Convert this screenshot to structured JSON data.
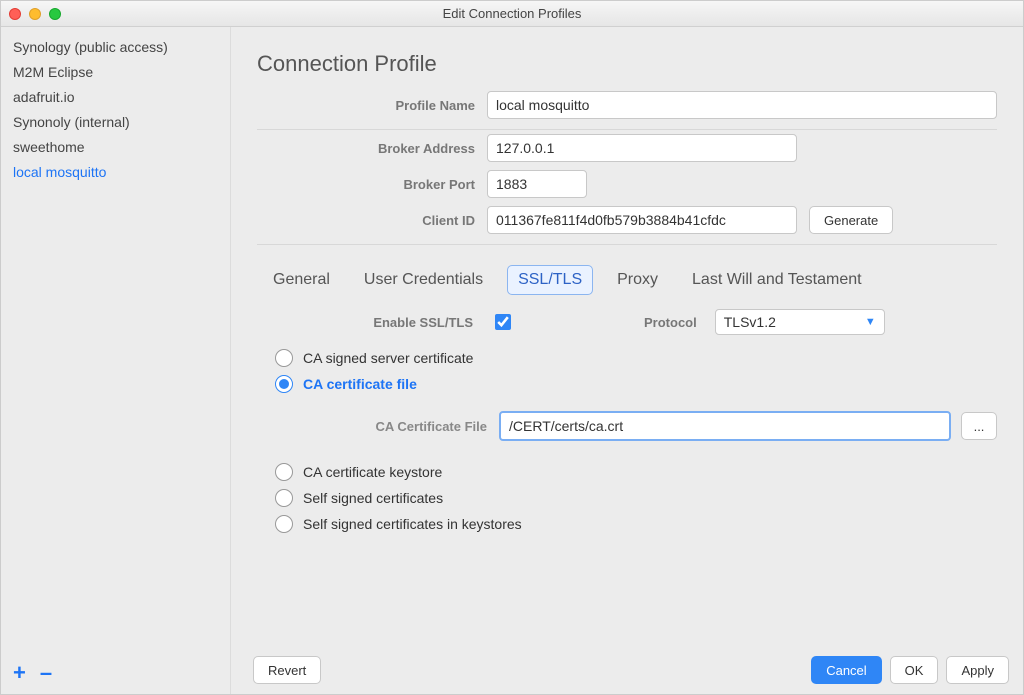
{
  "window": {
    "title": "Edit Connection Profiles"
  },
  "sidebar": {
    "items": [
      {
        "label": "Synology (public access)"
      },
      {
        "label": "M2M Eclipse"
      },
      {
        "label": "adafruit.io"
      },
      {
        "label": "Synonoly (internal)"
      },
      {
        "label": "sweethome"
      },
      {
        "label": "local mosquitto"
      }
    ],
    "selected_index": 5,
    "add_icon": "+",
    "remove_icon": "–"
  },
  "main": {
    "heading": "Connection Profile",
    "labels": {
      "profile_name": "Profile Name",
      "broker_address": "Broker Address",
      "broker_port": "Broker Port",
      "client_id": "Client ID",
      "generate": "Generate"
    },
    "values": {
      "profile_name": "local mosquitto",
      "broker_address": "127.0.0.1",
      "broker_port": "1883",
      "client_id": "011367fe811f4d0fb579b3884b41cfdc"
    },
    "tabs": [
      "General",
      "User Credentials",
      "SSL/TLS",
      "Proxy",
      "Last Will and Testament"
    ],
    "active_tab": 2,
    "ssl": {
      "enable_label": "Enable SSL/TLS",
      "enable_checked": true,
      "protocol_label": "Protocol",
      "protocol_value": "TLSv1.2",
      "radios": [
        "CA signed server certificate",
        "CA certificate file",
        "CA certificate keystore",
        "Self signed certificates",
        "Self signed certificates in keystores"
      ],
      "radios_checked": 1,
      "cert_label": "CA Certificate File",
      "cert_value": "/CERT/certs/ca.crt",
      "browse": "..."
    }
  },
  "footer": {
    "revert": "Revert",
    "cancel": "Cancel",
    "ok": "OK",
    "apply": "Apply"
  }
}
